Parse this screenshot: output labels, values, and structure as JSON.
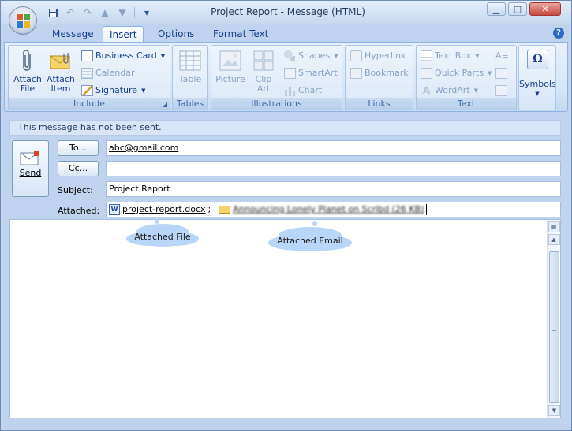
{
  "window": {
    "title": "Project Report - Message (HTML)"
  },
  "tabs": [
    "Message",
    "Insert",
    "Options",
    "Format Text"
  ],
  "ribbon": {
    "include": {
      "label": "Include",
      "attach_file": "Attach File",
      "attach_item": "Attach Item",
      "business_card": "Business Card",
      "calendar": "Calendar",
      "signature": "Signature"
    },
    "tables": {
      "label": "Tables",
      "table": "Table"
    },
    "illustrations": {
      "label": "Illustrations",
      "picture": "Picture",
      "clip_art": "Clip Art",
      "shapes": "Shapes",
      "smartart": "SmartArt",
      "chart": "Chart"
    },
    "links": {
      "label": "Links",
      "hyperlink": "Hyperlink",
      "bookmark": "Bookmark"
    },
    "text": {
      "label": "Text",
      "text_box": "Text Box",
      "quick_parts": "Quick Parts",
      "wordart": "WordArt"
    },
    "symbols": {
      "label": "Symbols"
    }
  },
  "infobar": {
    "message": "This message has not been sent."
  },
  "header": {
    "send_label": "Send",
    "to_label": "To...",
    "to_value": "abc@gmail.com",
    "cc_label": "Cc...",
    "cc_value": "",
    "subject_label": "Subject:",
    "subject_value": "Project Report",
    "attached_label": "Attached:",
    "attachment_file": "project-report.docx",
    "attachment_separator": ";",
    "attachment_email": "Announcing Lonely Planet on Scribd (26 KB)"
  },
  "callouts": {
    "attached_file": "Attached File",
    "attached_email": "Attached Email"
  }
}
